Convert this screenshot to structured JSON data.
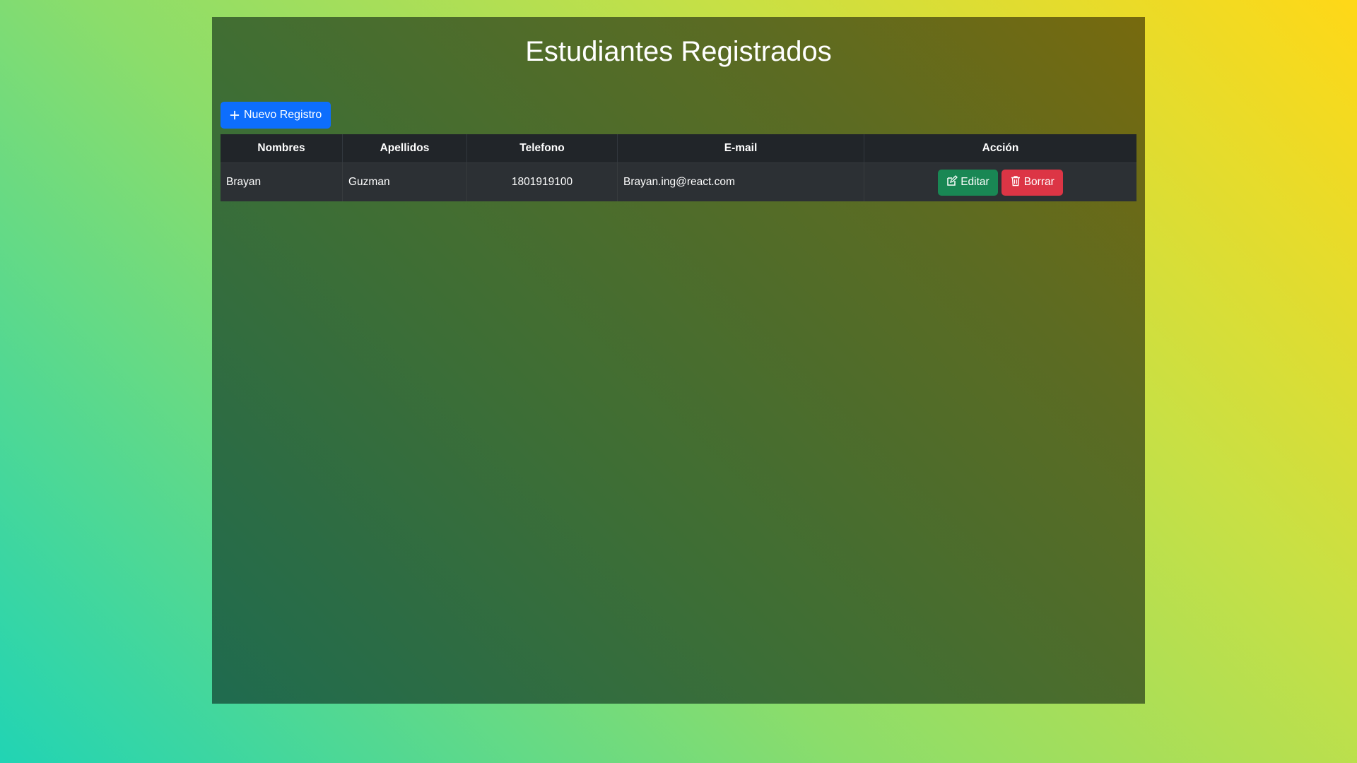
{
  "page": {
    "title": "Estudiantes Registrados"
  },
  "toolbar": {
    "new_label": "Nuevo Registro",
    "new_icon": "plus-icon",
    "new_color": "#0d6efd"
  },
  "table": {
    "headers": {
      "nombres": "Nombres",
      "apellidos": "Apellidos",
      "telefono": "Telefono",
      "email": "E-mail",
      "accion": "Acción"
    },
    "rows": [
      {
        "nombres": "Brayan",
        "apellidos": "Guzman",
        "telefono": "1801919100",
        "email": "Brayan.ing@react.com",
        "edit_label": "Editar",
        "edit_icon": "edit-icon",
        "delete_label": "Borrar",
        "delete_icon": "trash-icon"
      }
    ]
  },
  "colors": {
    "edit": "#198754",
    "delete": "#dc3545",
    "table_header": "#212529",
    "table_row": "#2c3034"
  }
}
